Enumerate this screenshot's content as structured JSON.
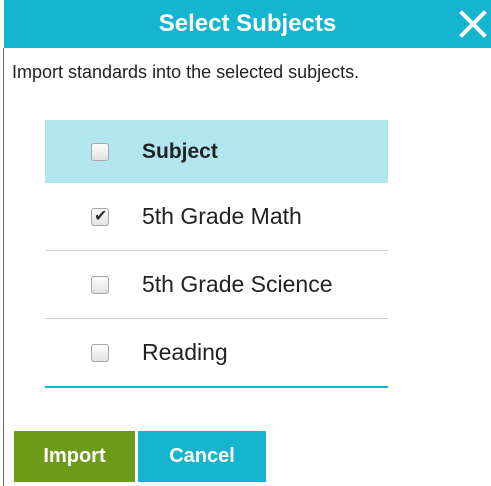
{
  "dialog": {
    "title": "Select Subjects",
    "close_icon": "close-icon",
    "description": "Import standards into the selected subjects."
  },
  "table": {
    "header": {
      "label": "Subject",
      "checked": false
    },
    "rows": [
      {
        "label": "5th Grade Math",
        "checked": true
      },
      {
        "label": "5th Grade Science",
        "checked": false
      },
      {
        "label": "Reading",
        "checked": false
      }
    ]
  },
  "buttons": {
    "import_label": "Import",
    "cancel_label": "Cancel"
  },
  "colors": {
    "accent": "#15b4cf",
    "header_row": "#b2e6ef",
    "import": "#6c9b1a"
  }
}
